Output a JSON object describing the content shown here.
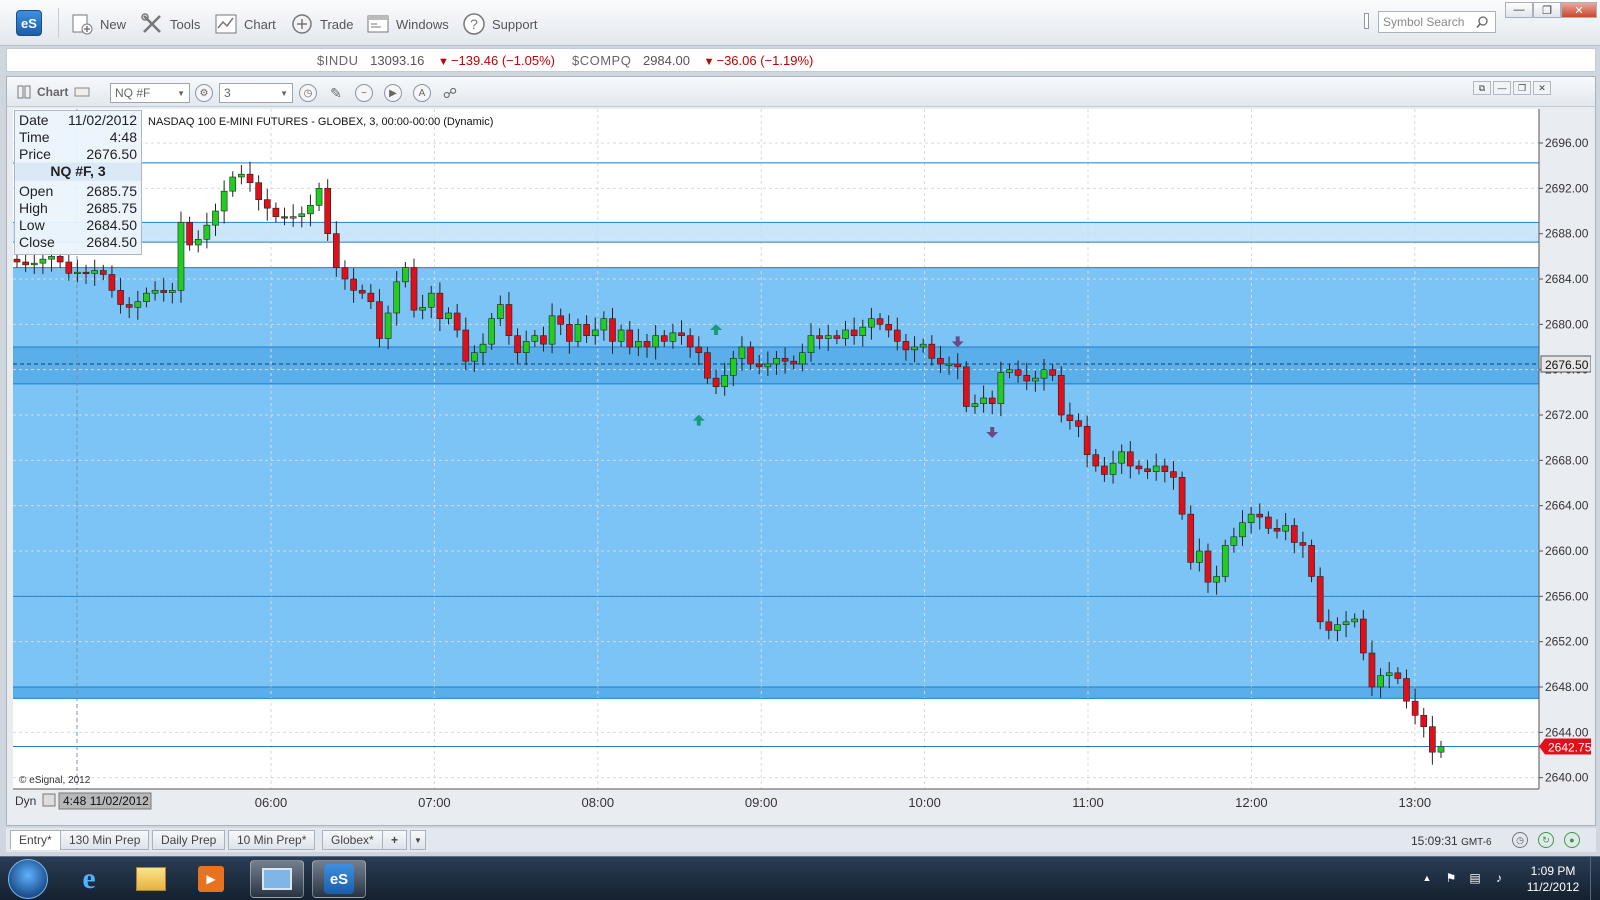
{
  "toolbar": {
    "logo": "eS",
    "buttons": [
      {
        "label": "New",
        "icon": "new-document-icon"
      },
      {
        "label": "Tools",
        "icon": "tools-icon"
      },
      {
        "label": "Chart",
        "icon": "chart-icon"
      },
      {
        "label": "Trade",
        "icon": "trade-icon"
      },
      {
        "label": "Windows",
        "icon": "windows-icon"
      },
      {
        "label": "Support",
        "icon": "help-icon"
      }
    ],
    "search_placeholder": "Symbol Search"
  },
  "ticker": [
    {
      "symbol": "$INDU",
      "last": "13093.16",
      "change": "−139.46 (−1.05%)",
      "direction": "down"
    },
    {
      "symbol": "$COMPQ",
      "last": "2984.00",
      "change": "−36.06 (−1.19%)",
      "direction": "down"
    }
  ],
  "chart_window": {
    "title": "Chart",
    "symbol": "NQ #F",
    "interval": "3",
    "description": "NASDAQ 100 E-MINI FUTURES - GLOBEX, 3, 00:00-00:00 (Dynamic)",
    "copyright": "© eSignal, 2012",
    "dyn_label": "Dyn",
    "cursor_label": "4:48 11/02/2012"
  },
  "data_window": {
    "date_label": "Date",
    "date": "11/02/2012",
    "time_label": "Time",
    "time": "4:48",
    "price_label": "Price",
    "price": "2676.50",
    "header": "NQ #F, 3",
    "open_label": "Open",
    "open": "2685.75",
    "high_label": "High",
    "high": "2685.75",
    "low_label": "Low",
    "low": "2684.50",
    "close_label": "Close",
    "close": "2684.50"
  },
  "chart_data": {
    "type": "candlestick",
    "y_axis": {
      "min": 2639,
      "max": 2699,
      "ticks": [
        "2696.00",
        "2692.00",
        "2688.00",
        "2684.00",
        "2680.00",
        "2676.00",
        "2672.00",
        "2668.00",
        "2664.00",
        "2660.00",
        "2656.00",
        "2652.00",
        "2648.00",
        "2644.00",
        "2640.00"
      ]
    },
    "x_axis": {
      "ticks": [
        "06:00",
        "07:00",
        "08:00",
        "09:00",
        "10:00",
        "11:00",
        "12:00",
        "13:00"
      ]
    },
    "crosshair_price": "2676.50",
    "last_price": "2642.75",
    "horizontal_levels": [
      2694.25,
      2689.0,
      2687.25,
      2685.0,
      2678.0,
      2674.75,
      2656.0,
      2648.0,
      2647.0,
      2642.75
    ],
    "shaded_zones": [
      {
        "from": 2687.25,
        "to": 2689.0,
        "shade": "light"
      },
      {
        "from": 2647.0,
        "to": 2685.0,
        "shade": "medium"
      },
      {
        "from": 2674.75,
        "to": 2678.0,
        "shade": "dark"
      },
      {
        "from": 2647.0,
        "to": 2648.0,
        "shade": "dark"
      }
    ],
    "closes": [
      2685.5,
      2685.25,
      2685.4,
      2685.75,
      2686.0,
      2685.5,
      2684.5,
      2684.6,
      2684.5,
      2684.75,
      2684.4,
      2683.0,
      2681.75,
      2681.5,
      2682.0,
      2682.75,
      2683.0,
      2682.8,
      2683.0,
      2689.0,
      2687.0,
      2687.5,
      2688.75,
      2690.0,
      2691.75,
      2693.0,
      2693.25,
      2692.5,
      2691.0,
      2690.25,
      2689.5,
      2689.4,
      2689.5,
      2689.75,
      2690.5,
      2692.0,
      2688.0,
      2685.0,
      2684.0,
      2683.0,
      2682.75,
      2682.0,
      2678.75,
      2681.0,
      2683.75,
      2685.0,
      2681.25,
      2681.5,
      2682.75,
      2680.5,
      2681.0,
      2679.5,
      2676.75,
      2677.5,
      2678.25,
      2680.5,
      2681.75,
      2679.0,
      2677.5,
      2678.5,
      2679.0,
      2678.25,
      2680.75,
      2680.0,
      2678.5,
      2680.0,
      2679.0,
      2679.5,
      2680.5,
      2678.5,
      2679.5,
      2678.0,
      2678.5,
      2678.0,
      2679.0,
      2678.5,
      2679.25,
      2679.0,
      2678.0,
      2677.5,
      2675.25,
      2674.5,
      2675.5,
      2677.0,
      2678.0,
      2676.5,
      2676.25,
      2676.5,
      2677.0,
      2676.75,
      2676.5,
      2677.5,
      2679.0,
      2678.75,
      2679.0,
      2678.75,
      2679.5,
      2679.0,
      2679.75,
      2680.5,
      2680.0,
      2679.5,
      2678.5,
      2677.75,
      2678.0,
      2678.25,
      2677.0,
      2676.5,
      2676.5,
      2676.25,
      2672.75,
      2673.0,
      2673.5,
      2673.0,
      2675.75,
      2676.0,
      2675.5,
      2675.0,
      2675.25,
      2676.0,
      2675.5,
      2672.0,
      2671.5,
      2671.0,
      2668.5,
      2667.5,
      2666.75,
      2667.75,
      2668.75,
      2667.5,
      2667.25,
      2667.0,
      2667.5,
      2667.0,
      2666.5,
      2663.25,
      2659.0,
      2660.0,
      2657.25,
      2657.75,
      2660.5,
      2661.25,
      2662.5,
      2663.25,
      2663.0,
      2662.0,
      2661.75,
      2662.25,
      2660.75,
      2660.5,
      2657.75,
      2653.75,
      2653.0,
      2653.5,
      2653.75,
      2654.0,
      2651.0,
      2648.0,
      2649.0,
      2649.25,
      2648.75,
      2646.75,
      2645.5,
      2644.5,
      2642.25,
      2642.75
    ]
  },
  "tabs": [
    {
      "label": "Entry*",
      "active": true
    },
    {
      "label": "130 Min Prep",
      "active": false
    },
    {
      "label": "Daily Prep",
      "active": false
    },
    {
      "label": "10 Min Prep*",
      "active": false
    },
    {
      "label": "Globex*",
      "active": false
    }
  ],
  "status": {
    "time": "15:09:31",
    "timezone": "GMT-6"
  },
  "taskbar": {
    "time": "1:09 PM",
    "date": "11/2/2012"
  }
}
